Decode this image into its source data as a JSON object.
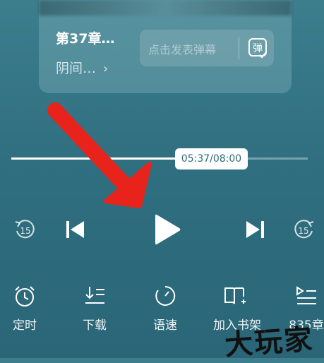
{
  "chapter": {
    "title": "第37章…",
    "subtitle": "阴间…",
    "subtitle_chevron": "›"
  },
  "danmaku": {
    "placeholder": "点击发表弹幕",
    "icon_label": "弹"
  },
  "progress": {
    "time": "05:37/08:00",
    "fraction": 0.7
  },
  "controls": {
    "rewind_seconds": "15",
    "forward_seconds": "15"
  },
  "bottom_bar": {
    "timer_label": "定时",
    "download_label": "下载",
    "speed_label": "语速",
    "bookshelf_label": "加入书架",
    "episodes_label": "835章"
  },
  "watermark": "大玩家",
  "colors": {
    "background": "#2f6f80",
    "annotation_arrow": "#e8231c"
  }
}
